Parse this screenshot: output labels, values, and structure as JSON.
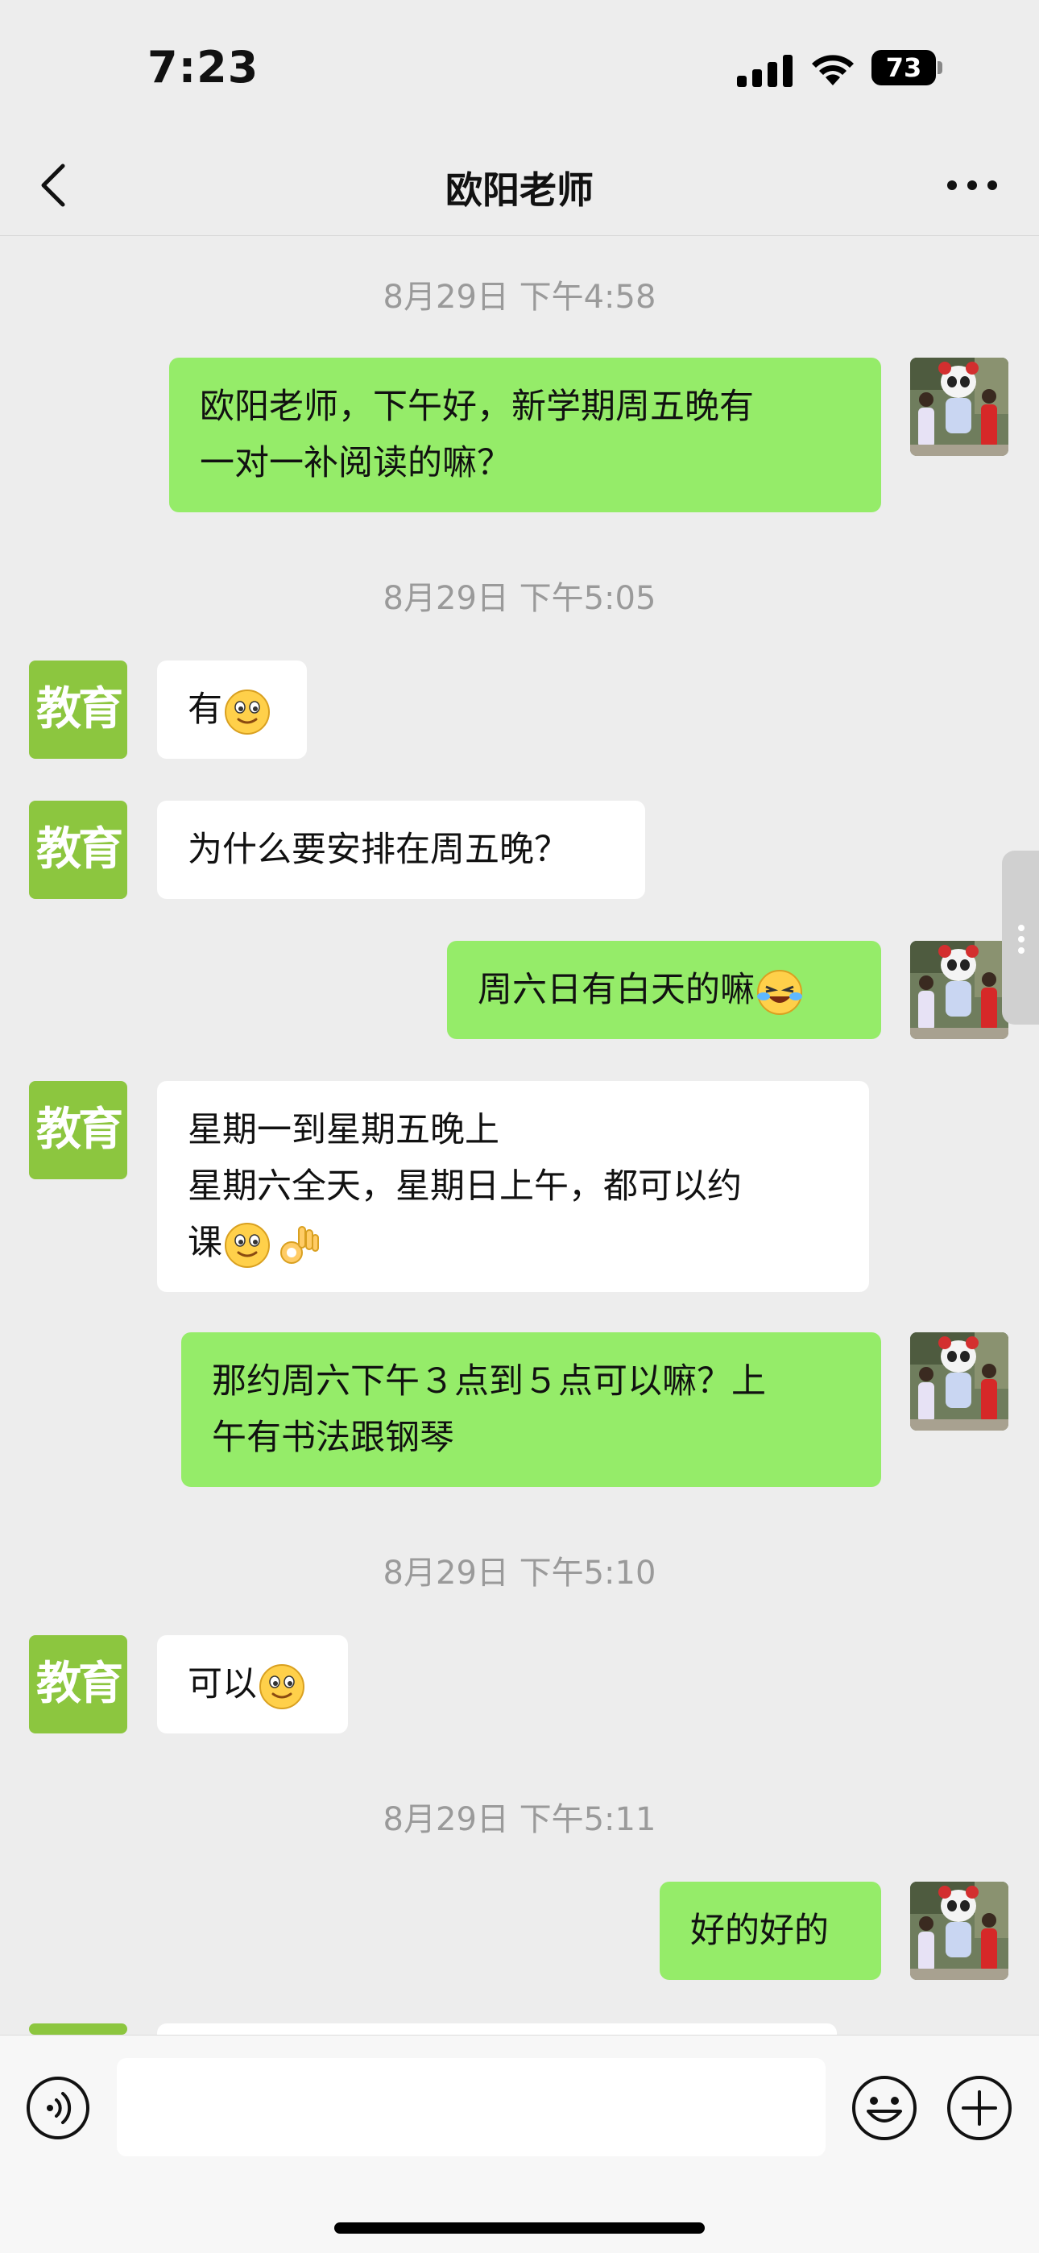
{
  "status_bar": {
    "time": "7:23",
    "battery": "73"
  },
  "header": {
    "title": "欧阳老师"
  },
  "timestamps": [
    "8月29日 下午4:58",
    "8月29日 下午5:05",
    "8月29日 下午5:10",
    "8月29日 下午5:11"
  ],
  "avatar": {
    "teacher_text": "教育"
  },
  "messages": [
    {
      "side": "right",
      "lines": [
        "欧阳老师，下午好，新学期周五晚有",
        "一对一补阅读的嘛？"
      ]
    },
    {
      "side": "left",
      "lines": [
        "有"
      ],
      "emoji": [
        "smile-emoji"
      ]
    },
    {
      "side": "left",
      "lines": [
        "为什么要安排在周五晚？"
      ]
    },
    {
      "side": "right",
      "lines": [
        "周六日有白天的嘛"
      ],
      "emoji": [
        "cry-laugh-emoji"
      ]
    },
    {
      "side": "left",
      "lines": [
        "星期一到星期五晚上",
        "星期六全天，星期日上午，都可以约",
        "课"
      ],
      "emoji": [
        "smile-emoji",
        "ok-hand-emoji"
      ]
    },
    {
      "side": "right",
      "lines": [
        "那约周六下午３点到５点可以嘛？上",
        "午有书法跟钢琴"
      ]
    },
    {
      "side": "left",
      "lines": [
        "可以"
      ],
      "emoji": [
        "smile-emoji"
      ]
    },
    {
      "side": "right",
      "lines": [
        "好的好的"
      ]
    }
  ],
  "colors": {
    "sent_bubble": "#95ec69",
    "received_bubble": "#ffffff",
    "background": "#ededed",
    "edu_avatar": "#8cc63f"
  },
  "input_bar": {
    "icons": [
      "voice-icon",
      "emoji-icon",
      "plus-icon"
    ]
  }
}
